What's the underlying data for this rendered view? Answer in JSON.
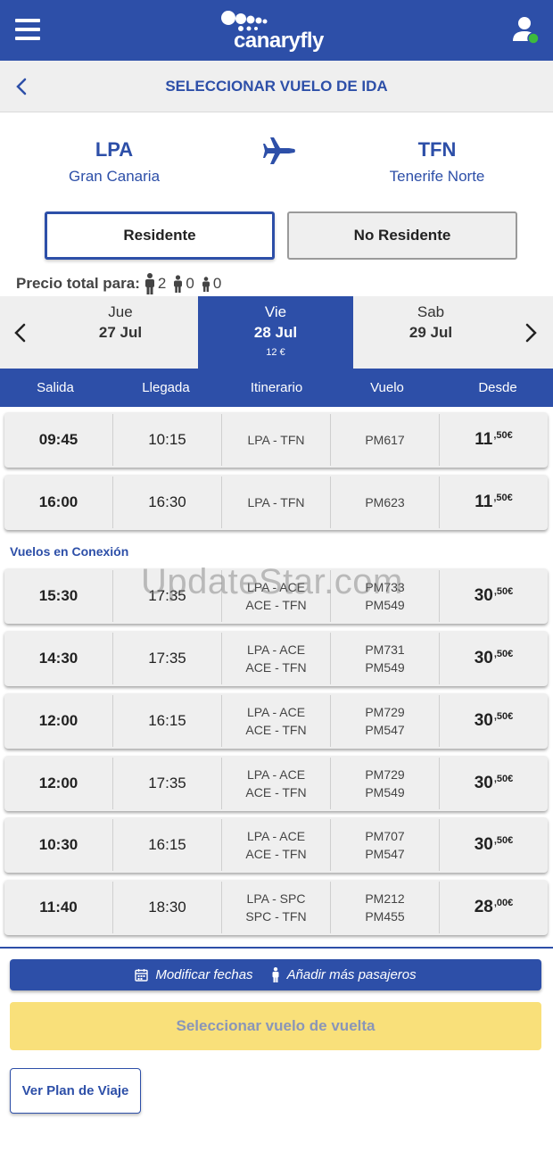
{
  "header": {
    "brand": "canaryfly",
    "menu_icon": "hamburger-menu-icon",
    "user_icon": "user-account-icon",
    "colors": {
      "primary": "#2d4fa8",
      "online_dot": "#3dbb3d"
    }
  },
  "titlebar": {
    "title": "SELECCIONAR VUELO DE IDA",
    "back_icon": "chevron-left-icon"
  },
  "route": {
    "origin": {
      "code": "LPA",
      "city": "Gran Canaria"
    },
    "destination": {
      "code": "TFN",
      "city": "Tenerife Norte"
    },
    "icon": "airplane-icon"
  },
  "resident": {
    "options": [
      "Residente",
      "No Residente"
    ],
    "selected": "Residente"
  },
  "passengers": {
    "label": "Precio total para:",
    "adults": "2",
    "children": "0",
    "infants": "0"
  },
  "dates": [
    {
      "dow": "Jue",
      "dm": "27 Jul",
      "price": ""
    },
    {
      "dow": "Vie",
      "dm": "28 Jul",
      "price": "12 €"
    },
    {
      "dow": "Sab",
      "dm": "29 Jul",
      "price": ""
    }
  ],
  "selected_date_index": 1,
  "columns": [
    "Salida",
    "Llegada",
    "Itinerario",
    "Vuelo",
    "Desde"
  ],
  "direct_flights": [
    {
      "dep": "09:45",
      "arr": "10:15",
      "route": [
        "LPA - TFN"
      ],
      "flight": [
        "PM617"
      ],
      "price_int": "11",
      "price_dec": ",50€"
    },
    {
      "dep": "16:00",
      "arr": "16:30",
      "route": [
        "LPA - TFN"
      ],
      "flight": [
        "PM623"
      ],
      "price_int": "11",
      "price_dec": ",50€"
    }
  ],
  "connections_label": "Vuelos en Conexión",
  "connection_flights": [
    {
      "dep": "15:30",
      "arr": "17:35",
      "route": [
        "LPA - ACE",
        "ACE - TFN"
      ],
      "flight": [
        "PM733",
        "PM549"
      ],
      "price_int": "30",
      "price_dec": ",50€"
    },
    {
      "dep": "14:30",
      "arr": "17:35",
      "route": [
        "LPA - ACE",
        "ACE - TFN"
      ],
      "flight": [
        "PM731",
        "PM549"
      ],
      "price_int": "30",
      "price_dec": ",50€"
    },
    {
      "dep": "12:00",
      "arr": "16:15",
      "route": [
        "LPA - ACE",
        "ACE - TFN"
      ],
      "flight": [
        "PM729",
        "PM547"
      ],
      "price_int": "30",
      "price_dec": ",50€"
    },
    {
      "dep": "12:00",
      "arr": "17:35",
      "route": [
        "LPA - ACE",
        "ACE - TFN"
      ],
      "flight": [
        "PM729",
        "PM549"
      ],
      "price_int": "30",
      "price_dec": ",50€"
    },
    {
      "dep": "10:30",
      "arr": "16:15",
      "route": [
        "LPA - ACE",
        "ACE - TFN"
      ],
      "flight": [
        "PM707",
        "PM547"
      ],
      "price_int": "30",
      "price_dec": ",50€"
    },
    {
      "dep": "11:40",
      "arr": "18:30",
      "route": [
        "LPA - SPC",
        "SPC - TFN"
      ],
      "flight": [
        "PM212",
        "PM455"
      ],
      "price_int": "28",
      "price_dec": ",00€"
    }
  ],
  "watermark": "UpdateStar.com",
  "actions": {
    "modify_dates": "Modificar fechas",
    "add_passengers": "Añadir más pasajeros",
    "select_return": "Seleccionar vuelo de vuelta",
    "view_plan": "Ver Plan de Viaje",
    "return_button_color": "#f9e07a"
  }
}
